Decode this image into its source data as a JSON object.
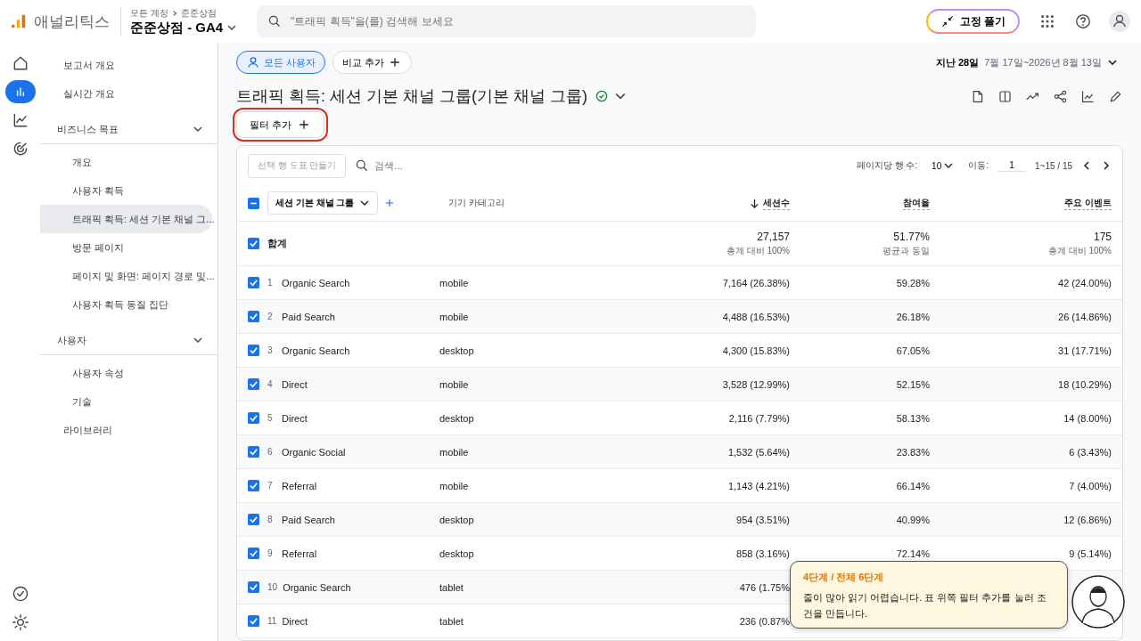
{
  "app": {
    "name": "애널리틱스",
    "breadcrumb": [
      "모든 계정",
      "준준상점"
    ],
    "property": "준준상점 - GA4"
  },
  "search": {
    "placeholder": "\"트래픽 획득\"을(를) 검색해 보세요"
  },
  "unpin_button": "고정 풀기",
  "rail": [
    {
      "selected": false
    },
    {
      "selected": true
    },
    {
      "selected": false
    },
    {
      "selected": false
    }
  ],
  "sidebar": {
    "items": [
      {
        "kind": "link",
        "label": "보고서 개요",
        "selected": false
      },
      {
        "kind": "link",
        "label": "실시간 개요",
        "selected": false
      },
      {
        "kind": "section",
        "label": "비즈니스 목표",
        "expanded": true,
        "children": [
          {
            "label": "개요",
            "selected": false
          },
          {
            "label": "사용자 획득",
            "selected": false
          },
          {
            "label": "트래픽 획득: 세션 기본 채널 그...",
            "selected": true
          },
          {
            "label": "방문 페이지",
            "selected": false
          },
          {
            "label": "페이지 및 화면: 페이지 경로 및...",
            "selected": false
          },
          {
            "label": "사용자 획득 동질 집단",
            "selected": false
          }
        ]
      },
      {
        "kind": "section",
        "label": "사용자",
        "expanded": true,
        "children": [
          {
            "label": "사용자 속성",
            "selected": false
          },
          {
            "label": "기술",
            "selected": false
          }
        ]
      },
      {
        "kind": "link",
        "label": "라이브러리",
        "selected": false
      }
    ]
  },
  "segments": {
    "active": "모든 사용자",
    "compare": "비교 추가"
  },
  "date": {
    "preset": "지난 28일",
    "range": "7월 17일~2026년 8월 13일"
  },
  "report": {
    "title": "트래픽 획득: 세션 기본 채널 그룹(기본 채널 그룹)",
    "verified": true
  },
  "filter_button": {
    "label": "필터 추가",
    "highlighted": true
  },
  "table": {
    "chart_button": "선택 행 도표 만들기",
    "search_placeholder": "검색...",
    "rows_per_page_label": "페이지당 행 수:",
    "rows_per_page": "10",
    "goto_label": "이동:",
    "goto_value": "1",
    "range": "1~15 / 15",
    "select_all_partial": true,
    "dimension": "세션 기본 채널 그룹",
    "secondary": "기기 카테고리",
    "columns": [
      {
        "label": "세션수",
        "sorted": true
      },
      {
        "label": "참여율",
        "sorted": false
      },
      {
        "label": "주요 이벤트",
        "sorted": false
      }
    ],
    "total": {
      "label": "합계",
      "checked": true,
      "values": [
        {
          "value": "27,157",
          "note": "총계 대비 100%"
        },
        {
          "value": "51.77%",
          "note": "평균과 동일"
        },
        {
          "value": "175",
          "note": "총계 대비 100%"
        }
      ]
    },
    "rows": [
      {
        "index": "1",
        "channel": "Organic Search",
        "device": "mobile",
        "checked": true,
        "cells": [
          "7,164 (26.38%)",
          "59.28%",
          "42 (24.00%)"
        ]
      },
      {
        "index": "2",
        "channel": "Paid Search",
        "device": "mobile",
        "checked": true,
        "cells": [
          "4,488 (16.53%)",
          "26.18%",
          "26 (14.86%)"
        ]
      },
      {
        "index": "3",
        "channel": "Organic Search",
        "device": "desktop",
        "checked": true,
        "cells": [
          "4,300 (15.83%)",
          "67.05%",
          "31 (17.71%)"
        ]
      },
      {
        "index": "4",
        "channel": "Direct",
        "device": "mobile",
        "checked": true,
        "cells": [
          "3,528 (12.99%)",
          "52.15%",
          "18 (10.29%)"
        ]
      },
      {
        "index": "5",
        "channel": "Direct",
        "device": "desktop",
        "checked": true,
        "cells": [
          "2,116 (7.79%)",
          "58.13%",
          "14 (8.00%)"
        ]
      },
      {
        "index": "6",
        "channel": "Organic Social",
        "device": "mobile",
        "checked": true,
        "cells": [
          "1,532 (5.64%)",
          "23.83%",
          "6 (3.43%)"
        ]
      },
      {
        "index": "7",
        "channel": "Referral",
        "device": "mobile",
        "checked": true,
        "cells": [
          "1,143 (4.21%)",
          "66.14%",
          "7 (4.00%)"
        ]
      },
      {
        "index": "8",
        "channel": "Paid Search",
        "device": "desktop",
        "checked": true,
        "cells": [
          "954 (3.51%)",
          "40.99%",
          "12 (6.86%)"
        ]
      },
      {
        "index": "9",
        "channel": "Referral",
        "device": "desktop",
        "checked": true,
        "cells": [
          "858 (3.16%)",
          "72.14%",
          "9 (5.14%)"
        ]
      },
      {
        "index": "10",
        "channel": "Organic Search",
        "device": "tablet",
        "checked": true,
        "cells": [
          "476 (1.75%"
        ]
      },
      {
        "index": "11",
        "channel": "Direct",
        "device": "tablet",
        "checked": true,
        "cells": [
          "236 (0.87%"
        ]
      }
    ]
  },
  "guide": {
    "step": "4단계 / 전체 6단계",
    "message": "줄이 많아 읽기 어렵습니다. 표 위쪽 필터 추가를 눌러 조건을 만듭니다."
  }
}
